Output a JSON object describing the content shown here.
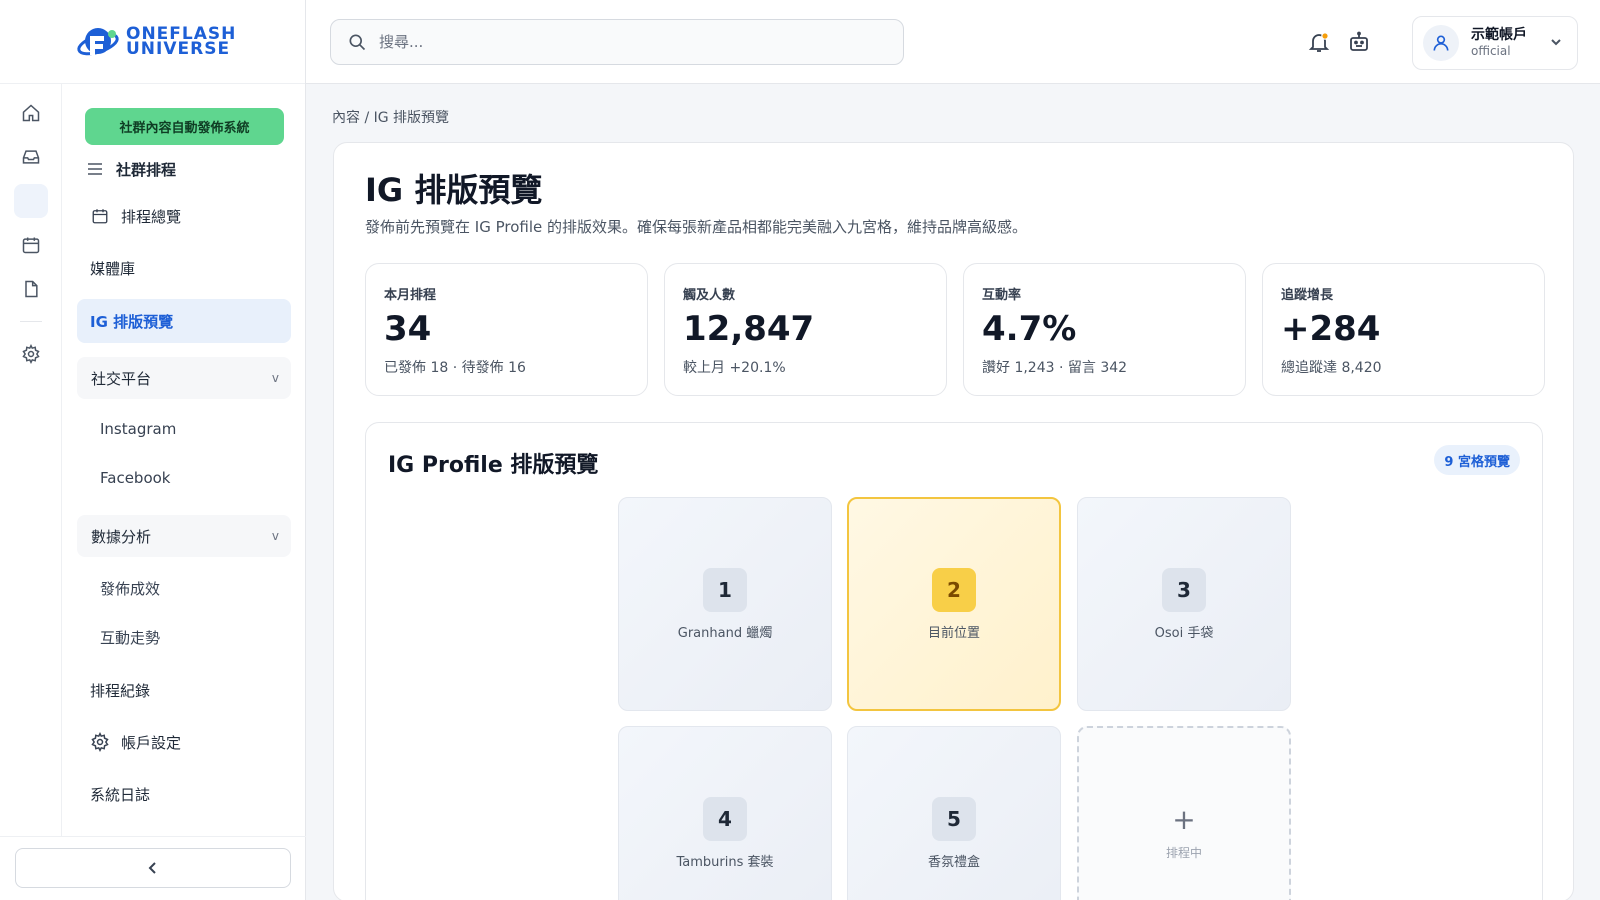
{
  "brand": {
    "logo_line1": "ONEFLASH",
    "logo_line2": "UNIVERSE",
    "primary_color": "#1d5fd6",
    "accent_color": "#5fd68f"
  },
  "sidebar": {
    "system_button": "社群內容自動發佈系統",
    "section_title": "社群排程",
    "items": [
      {
        "label": "排程總覽",
        "icon": "calendar-icon"
      },
      {
        "label": "媒體庫"
      },
      {
        "label": "IG 排版預覽",
        "active": true
      }
    ],
    "group_social": {
      "label": "社交平台",
      "chevron": "v",
      "children": [
        "Instagram",
        "Facebook"
      ]
    },
    "group_analytics": {
      "label": "數據分析",
      "chevron": "v",
      "children": [
        "發佈成效",
        "互動走勢"
      ]
    },
    "bottom_items": [
      {
        "label": "排程紀錄"
      },
      {
        "label": "帳戶設定",
        "icon": "gear-icon"
      },
      {
        "label": "系統日誌"
      }
    ],
    "rail_icons": [
      "home-icon",
      "inbox-icon",
      "layout-icon",
      "calendar-icon",
      "file-icon",
      "gear-icon"
    ],
    "collapse_icon": "chevron-left-icon"
  },
  "header": {
    "search_placeholder": "搜尋...",
    "notification_icon": "bell-icon",
    "bot_icon": "robot-icon",
    "account": {
      "name": "示範帳戶",
      "role": "official"
    }
  },
  "main": {
    "breadcrumb": "內容 / IG 排版預覽",
    "title": "IG 排版預覽",
    "description": "發佈前先預覽在 IG Profile 的排版效果。確保每張新產品相都能完美融入九宮格，維持品牌高級感。",
    "stats": [
      {
        "label": "本月排程",
        "value": "34",
        "sub": "已發佈 18 · 待發佈 16"
      },
      {
        "label": "觸及人數",
        "value": "12,847",
        "sub": "較上月 +20.1%"
      },
      {
        "label": "互動率",
        "value": "4.7%",
        "sub": "讚好 1,243 · 留言 342"
      },
      {
        "label": "追蹤增長",
        "value": "+284",
        "sub": "總追蹤達 8,420"
      }
    ],
    "grid": {
      "title": "IG Profile 排版預覽",
      "badge": "9 宮格預覽",
      "tiles": [
        {
          "num": "1",
          "label": "Granhand 蠟燭"
        },
        {
          "num": "2",
          "label": "目前位置"
        },
        {
          "num": "3",
          "label": "Osoi 手袋"
        },
        {
          "num": "4",
          "label": "Tamburins 套裝"
        },
        {
          "num": "5",
          "label": "香氛禮盒"
        },
        {
          "num": "+",
          "label": "排程中"
        }
      ]
    }
  }
}
